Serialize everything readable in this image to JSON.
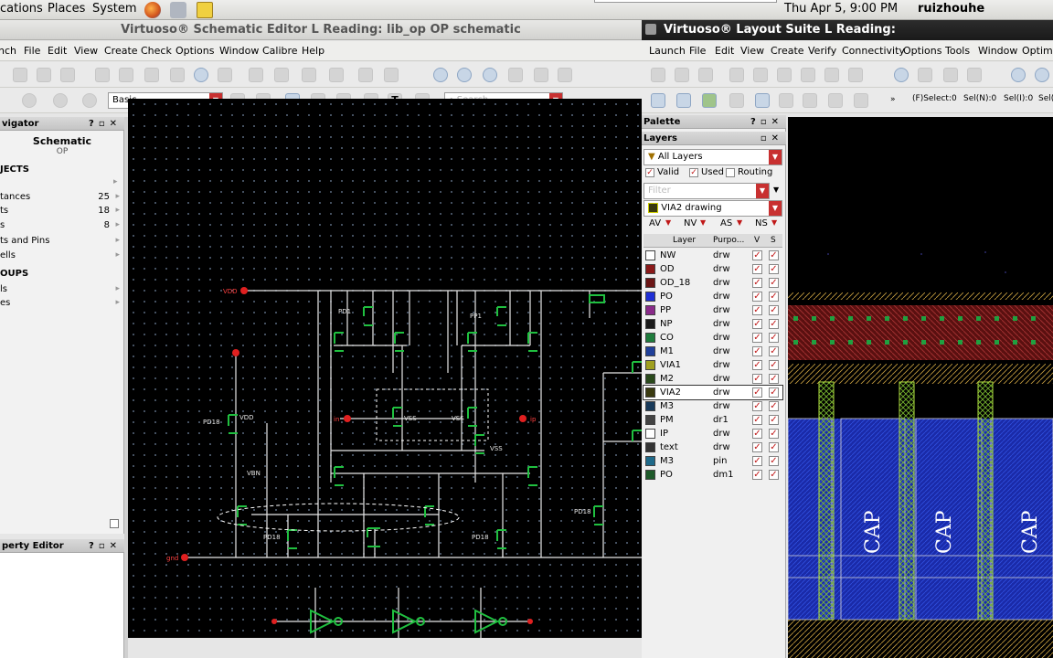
{
  "system_bar": {
    "menu_applications": "cations",
    "menu_places": "Places",
    "menu_system": "System",
    "clock": "Thu Apr 5,  9:00 PM",
    "user": "ruizhouhe"
  },
  "schematic_window": {
    "title": "Virtuoso® Schematic Editor L Reading: lib_op OP schematic",
    "menu": [
      "nch",
      "File",
      "Edit",
      "View",
      "Create",
      "Check",
      "Options",
      "Window",
      "Calibre",
      "Help"
    ],
    "workspace_value": "Basic",
    "search_placeholder": "Search",
    "navigator": {
      "header": "vigator",
      "title": "Schematic",
      "subtitle": "OP",
      "objects_header": "JECTS",
      "objects": [
        {
          "label": "tances",
          "count": "25"
        },
        {
          "label": "ts",
          "count": "18"
        },
        {
          "label": "s",
          "count": "8"
        },
        {
          "label": "ts and Pins",
          "count": ""
        },
        {
          "label": "ells",
          "count": ""
        }
      ],
      "groups_header": "OUPS",
      "groups": [
        {
          "label": "ls"
        },
        {
          "label": "es"
        }
      ]
    },
    "property_editor_header": "perty Editor",
    "schematic_labels": {
      "vdd": "VDD",
      "gnd": "gnd",
      "pd1": "PD1",
      "pp1": "PP1",
      "pd18": "PD18",
      "vdd_small": "VDD",
      "vss": "VSS",
      "vbn": "VBN",
      "in": "in",
      "ip": "ip"
    }
  },
  "layout_window": {
    "title": "Virtuoso® Layout Suite L Reading:",
    "menu": [
      "Launch",
      "File",
      "Edit",
      "View",
      "Create",
      "Verify",
      "Connectivity",
      "Options",
      "Tools",
      "Window",
      "Optimiz"
    ],
    "status": {
      "select": "(F)Select:0",
      "sel_n": "Sel(N):0",
      "sel_i": "Sel(I):0",
      "sel_o": "Sel(O"
    },
    "palette_header": "Palette",
    "layers_header": "Layers",
    "layer_set": "All Layers",
    "filters": {
      "valid": "Valid",
      "used": "Used",
      "routing": "Routing"
    },
    "filter_placeholder": "Filter",
    "current_layer": "VIA2 drawing",
    "visibility_buttons": [
      "AV",
      "NV",
      "AS",
      "NS"
    ],
    "columns": [
      "Layer",
      "Purpo...",
      "V",
      "S"
    ],
    "layers": [
      {
        "name": "NW",
        "purpose": "drw",
        "color": "#ffffff"
      },
      {
        "name": "OD",
        "purpose": "drw",
        "color": "#8b1a1a"
      },
      {
        "name": "OD_18",
        "purpose": "drw",
        "color": "#6b1616"
      },
      {
        "name": "PO",
        "purpose": "drw",
        "color": "#1f2fd6"
      },
      {
        "name": "PP",
        "purpose": "drw",
        "color": "#8a2b8a"
      },
      {
        "name": "NP",
        "purpose": "drw",
        "color": "#1b1b1b"
      },
      {
        "name": "CO",
        "purpose": "drw",
        "color": "#1e7c3c"
      },
      {
        "name": "M1",
        "purpose": "drw",
        "color": "#20409a"
      },
      {
        "name": "VIA1",
        "purpose": "drw",
        "color": "#a0a020"
      },
      {
        "name": "M2",
        "purpose": "drw",
        "color": "#2a4a1c"
      },
      {
        "name": "VIA2",
        "purpose": "drw",
        "color": "#3a3a10"
      },
      {
        "name": "M3",
        "purpose": "drw",
        "color": "#183a5a"
      },
      {
        "name": "PM",
        "purpose": "dr1",
        "color": "#444444"
      },
      {
        "name": "IP",
        "purpose": "drw",
        "color": "#ffffff"
      },
      {
        "name": "text",
        "purpose": "drw",
        "color": "#333333"
      },
      {
        "name": "M3",
        "purpose": "pin",
        "color": "#1f6a8a"
      },
      {
        "name": "PO",
        "purpose": "dm1",
        "color": "#1e5a2a"
      }
    ],
    "selected_layer_index": 10,
    "cap_label": "CAP"
  }
}
